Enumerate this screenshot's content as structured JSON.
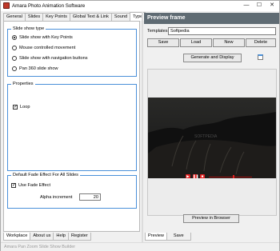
{
  "window": {
    "title": "Amara Photo Animation Software",
    "min": "—",
    "max": "☐",
    "close": "✕"
  },
  "top_tabs": [
    "General",
    "Slides",
    "Key Points",
    "Global Text & Link",
    "Sound",
    "Type"
  ],
  "slide_show_type": {
    "legend": "Slide show type",
    "options": [
      {
        "label": "Slide show with Key Points",
        "checked": true
      },
      {
        "label": "Mouse controlled movement",
        "checked": false
      },
      {
        "label": "Slide show with navigation buttons",
        "checked": false
      },
      {
        "label": "Pan 360 slide show",
        "checked": false
      }
    ]
  },
  "properties": {
    "legend": "Properties",
    "loop_label": "Loop",
    "loop_checked": true
  },
  "fade": {
    "legend": "Default Fade Effect For All Slides",
    "use_label": "Use Fade Effect",
    "use_checked": true,
    "alpha_label": "Alpha increment",
    "alpha_value": "20"
  },
  "bottom_left_tabs": [
    "Workplace",
    "About us",
    "Help",
    "Register"
  ],
  "status": {
    "text": "Amara Pan Zoom Slide Show Builder"
  },
  "preview": {
    "header": "Preview frame",
    "templates_label": "Templates:",
    "templates_value": "Softpedia",
    "save": "Save",
    "load": "Load",
    "new": "New",
    "delete": "Delete",
    "generate": "Generate and Display",
    "watermark": "SOFTPEDIA",
    "preview_browser": "Preview in Browser"
  },
  "bottom_right_tabs": [
    "Preview",
    "Save"
  ],
  "check_mark": "✓",
  "colors": {
    "accent": "#4a90d9",
    "header": "#5f6b73",
    "player": "#e02020"
  }
}
